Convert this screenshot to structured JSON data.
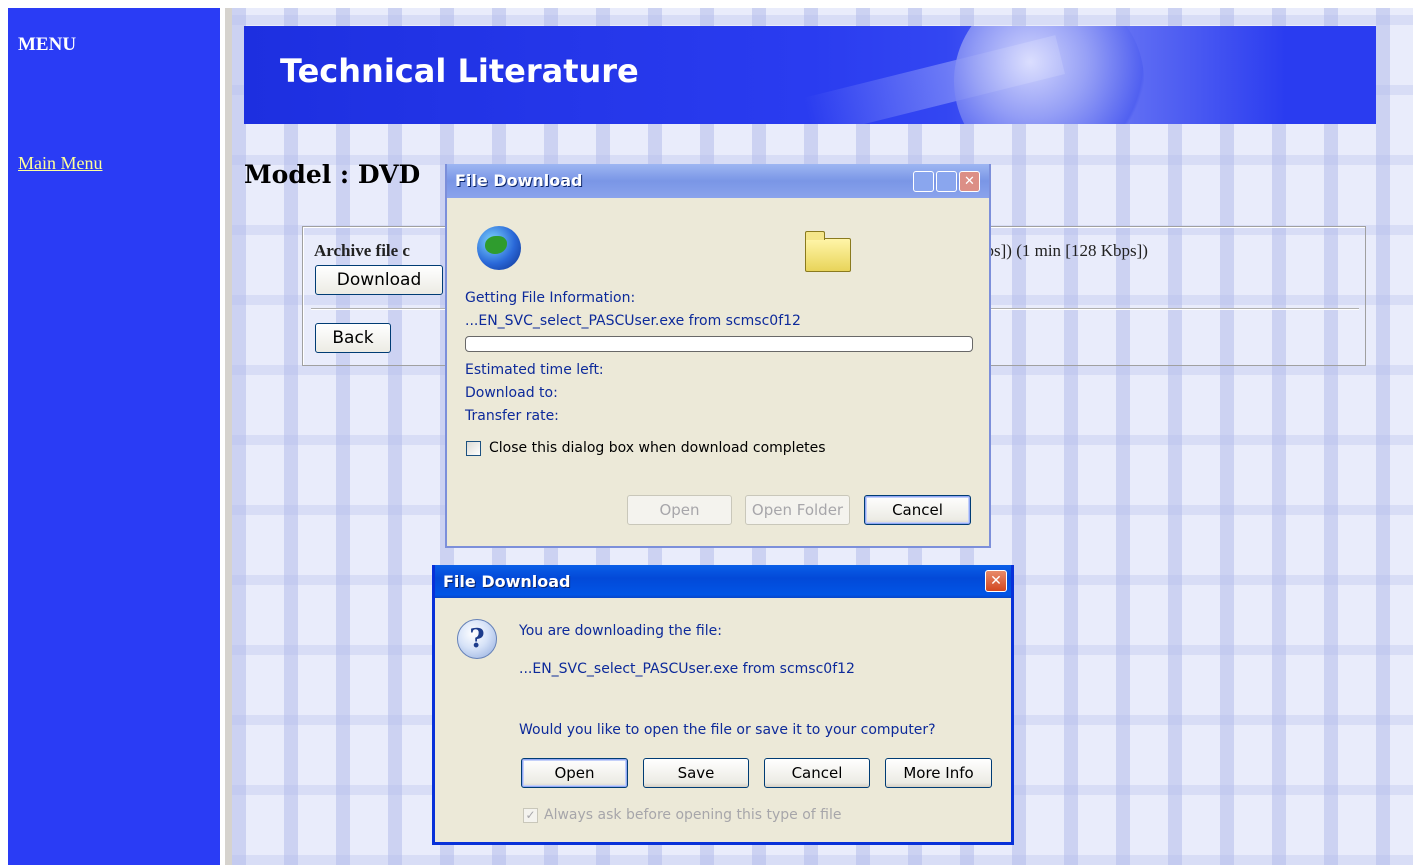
{
  "menu": {
    "title": "MENU",
    "main_menu_link": "Main Menu"
  },
  "banner": {
    "title": "Technical Literature"
  },
  "page": {
    "model_heading": "Model : DVD",
    "archive_label": "Archive file c",
    "archive_rate": "bps]) (1 min [128 Kbps])",
    "download_button": "Download",
    "back_button": "Back"
  },
  "progress_dialog": {
    "title": "File Download",
    "getting_info": "Getting File Information:",
    "file_line": "...EN_SVC_select_PASCUser.exe from scmsc0f12",
    "progress_percent": 0,
    "estimated_time_left": "Estimated time left:",
    "download_to": "Download to:",
    "transfer_rate": "Transfer rate:",
    "close_checkbox_label": "Close this dialog box when download completes",
    "close_checkbox_checked": false,
    "buttons": {
      "open": "Open",
      "open_folder": "Open Folder",
      "cancel": "Cancel"
    }
  },
  "question_dialog": {
    "title": "File Download",
    "close_glyph": "✕",
    "line1": "You are downloading the file:",
    "file_line": "...EN_SVC_select_PASCUser.exe from scmsc0f12",
    "question": "Would you like to open the file or save it to your computer?",
    "buttons": {
      "open": "Open",
      "save": "Save",
      "cancel": "Cancel",
      "more_info": "More Info"
    },
    "always_ask_label": "Always ask before opening this type of file",
    "always_ask_checked": true
  },
  "icons": {
    "question": "?"
  },
  "colors": {
    "menu_bg": "#2a3cf5",
    "link": "#ffff99",
    "xp_active_title": "#0349d8",
    "xp_inactive_title": "#7a96e6",
    "dialog_bg": "#ece9d8"
  }
}
